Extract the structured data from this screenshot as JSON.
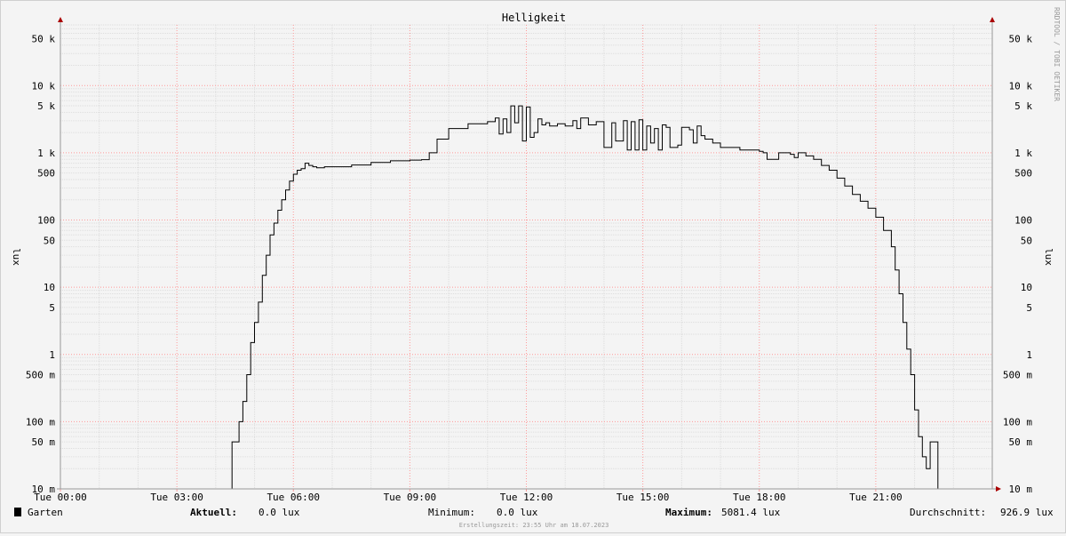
{
  "chart_data": {
    "type": "line",
    "title": "Helligkeit",
    "ylabel": "lux",
    "ylabel_right": "lux",
    "scale": "log",
    "ylim": [
      0.01,
      80000
    ],
    "xlim": [
      0,
      24
    ],
    "x_ticks": [
      {
        "v": 0,
        "label": "Tue 00:00"
      },
      {
        "v": 3,
        "label": "Tue 03:00"
      },
      {
        "v": 6,
        "label": "Tue 06:00"
      },
      {
        "v": 9,
        "label": "Tue 09:00"
      },
      {
        "v": 12,
        "label": "Tue 12:00"
      },
      {
        "v": 15,
        "label": "Tue 15:00"
      },
      {
        "v": 18,
        "label": "Tue 18:00"
      },
      {
        "v": 21,
        "label": "Tue 21:00"
      }
    ],
    "y_ticks": [
      {
        "v": 0.01,
        "label": "10 m"
      },
      {
        "v": 0.05,
        "label": "50 m"
      },
      {
        "v": 0.1,
        "label": "100 m"
      },
      {
        "v": 0.5,
        "label": "500 m"
      },
      {
        "v": 1,
        "label": "1"
      },
      {
        "v": 5,
        "label": "5"
      },
      {
        "v": 10,
        "label": "10"
      },
      {
        "v": 50,
        "label": "50"
      },
      {
        "v": 100,
        "label": "100"
      },
      {
        "v": 500,
        "label": "500"
      },
      {
        "v": 1000,
        "label": "1 k"
      },
      {
        "v": 5000,
        "label": "5 k"
      },
      {
        "v": 10000,
        "label": "10 k"
      },
      {
        "v": 50000,
        "label": "50 k"
      }
    ],
    "grid": true,
    "series": [
      {
        "name": "Garten",
        "x": [
          0,
          4.4,
          4.42,
          4.55,
          4.6,
          4.7,
          4.8,
          4.9,
          5.0,
          5.1,
          5.2,
          5.3,
          5.4,
          5.5,
          5.6,
          5.7,
          5.8,
          5.9,
          6.0,
          6.1,
          6.2,
          6.3,
          6.4,
          6.5,
          6.6,
          6.8,
          7.0,
          7.5,
          8.0,
          8.5,
          9.0,
          9.3,
          9.5,
          9.7,
          10.0,
          10.5,
          11.0,
          11.2,
          11.3,
          11.4,
          11.5,
          11.6,
          11.7,
          11.8,
          11.9,
          12.0,
          12.1,
          12.2,
          12.3,
          12.4,
          12.5,
          12.6,
          12.8,
          13.0,
          13.2,
          13.3,
          13.4,
          13.6,
          13.8,
          14.0,
          14.2,
          14.3,
          14.5,
          14.6,
          14.7,
          14.8,
          14.9,
          15.0,
          15.1,
          15.2,
          15.3,
          15.4,
          15.5,
          15.6,
          15.7,
          15.8,
          15.9,
          16.0,
          16.2,
          16.3,
          16.4,
          16.5,
          16.6,
          16.8,
          17.0,
          17.5,
          18.0,
          18.1,
          18.2,
          18.5,
          18.8,
          18.9,
          19.0,
          19.2,
          19.4,
          19.6,
          19.8,
          20.0,
          20.2,
          20.4,
          20.6,
          20.8,
          21.0,
          21.2,
          21.4,
          21.5,
          21.6,
          21.7,
          21.8,
          21.9,
          22.0,
          22.1,
          22.2,
          22.3,
          22.4,
          22.5,
          22.6,
          22.7,
          24
        ],
        "values": [
          0.01,
          0.01,
          0.05,
          0.05,
          0.1,
          0.2,
          0.5,
          1.5,
          3,
          6,
          15,
          30,
          60,
          90,
          140,
          200,
          280,
          380,
          480,
          550,
          580,
          700,
          650,
          620,
          600,
          620,
          620,
          660,
          720,
          760,
          780,
          790,
          1000,
          1600,
          2300,
          2700,
          2900,
          3300,
          1900,
          3200,
          2000,
          5000,
          2800,
          5000,
          1500,
          4800,
          1700,
          2000,
          3200,
          2600,
          2800,
          2500,
          2700,
          2500,
          3000,
          2300,
          3300,
          2600,
          2900,
          1200,
          2800,
          1500,
          3000,
          1100,
          2900,
          1100,
          3100,
          1100,
          2500,
          1400,
          2300,
          1100,
          2600,
          2400,
          1200,
          1200,
          1300,
          2400,
          2200,
          1400,
          2500,
          1800,
          1600,
          1400,
          1200,
          1100,
          1050,
          1000,
          800,
          1000,
          950,
          850,
          1000,
          900,
          800,
          650,
          550,
          420,
          320,
          240,
          190,
          150,
          110,
          70,
          40,
          18,
          8,
          3,
          1.2,
          0.5,
          0.15,
          0.06,
          0.03,
          0.02,
          0.05,
          0.05,
          0.01,
          0.01,
          0.01
        ]
      }
    ]
  },
  "legend": {
    "series_name": "Garten",
    "current_label": "Aktuell:",
    "current_value": "0.0 lux",
    "min_label": "Minimum:",
    "min_value": "0.0 lux",
    "max_label": "Maximum:",
    "max_value": "5081.4 lux",
    "avg_label": "Durchschnitt:",
    "avg_value": "926.9 lux"
  },
  "footer": "Erstellungszeit: 23:55 Uhr am 18.07.2023",
  "watermark": "RRDTOOL / TOBI OETIKER",
  "colors": {
    "line": "#000000",
    "minor_grid": "#dddddd",
    "major_grid": "#ff9999",
    "swatch": "#000000",
    "arrow": "#aa0000"
  }
}
